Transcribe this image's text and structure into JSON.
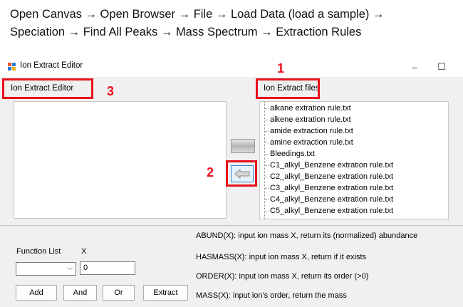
{
  "instructions": {
    "line1": "Open Canvas → Open Browser → File → Load Data (load a sample) →",
    "line2": "Speciation → Find All Peaks → Mass Spectrum → Extraction Rules"
  },
  "window": {
    "title": "Ion Extract Editor",
    "minimize_glyph": "–",
    "maximize_glyph": "☐"
  },
  "editor": {
    "label": "Ion Extract Editor"
  },
  "files": {
    "label": "Ion Extract files",
    "items": [
      "alkane extration rule.txt",
      "alkene extration rule.txt",
      "amide extraction rule.txt",
      "amine extraction rule.txt",
      "Bleedings.txt",
      "C1_alkyl_Benzene extration rule.txt",
      "C2_alkyl_Benzene extration rule.txt",
      "C3_alkyl_Benzene extration rule.txt",
      "C4_alkyl_Benzene extration rule.txt",
      "C5_alkyl_Benzene extration rule.txt"
    ]
  },
  "annotations": {
    "one": "1",
    "two": "2",
    "three": "3"
  },
  "functions": {
    "list_label": "Function List",
    "x_label": "X",
    "x_value": "0",
    "descriptions": [
      "ABUND(X): input ion mass X, return its (normalized) abundance",
      "HASMASS(X): input ion mass X, return if it exists",
      "ORDER(X): input ion mass X, return its order (>0)",
      "MASS(X): input ion's order, return the mass"
    ],
    "buttons": {
      "add": "Add",
      "and": "And",
      "or": "Or",
      "extract": "Extract"
    }
  },
  "icons": {
    "left_arrow": "left-arrow-icon",
    "app": "app-icon"
  },
  "colors": {
    "highlight": "#e8101a",
    "selected_border": "#2f86d6"
  }
}
